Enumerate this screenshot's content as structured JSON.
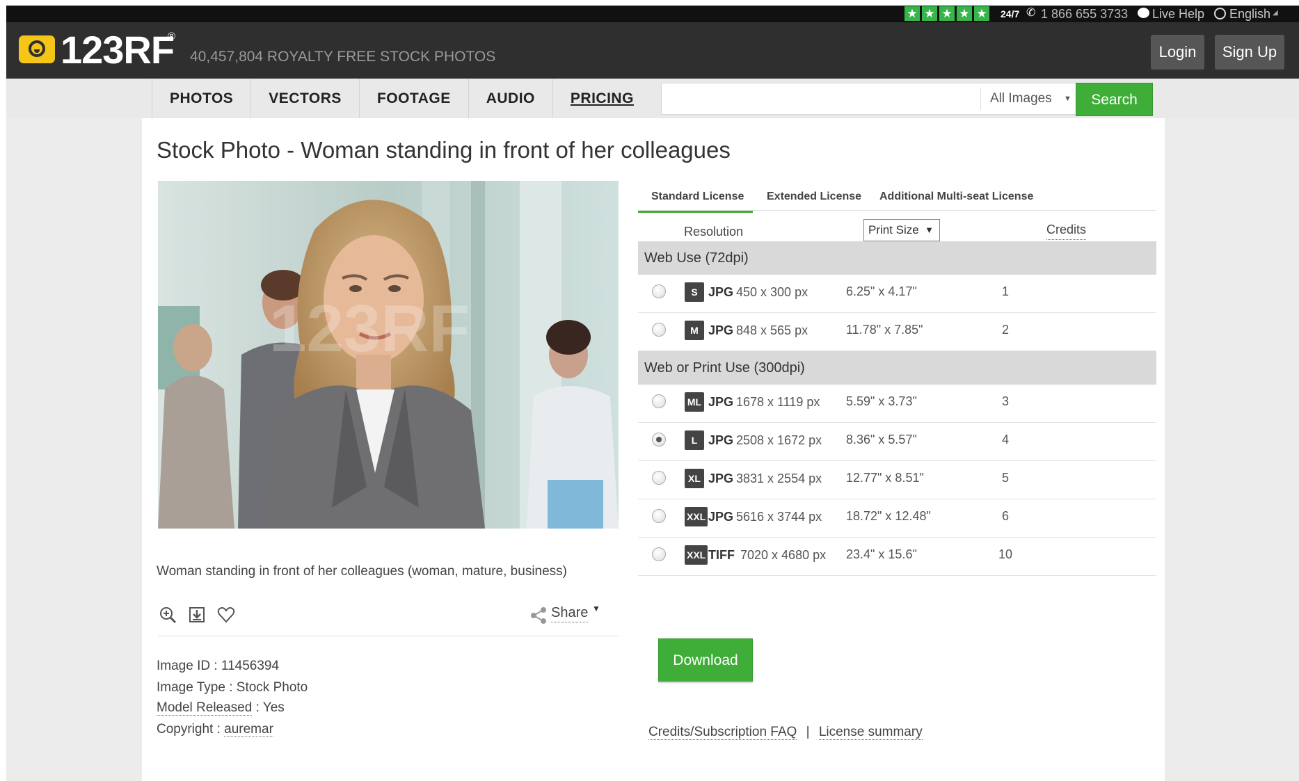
{
  "topbar": {
    "rating_stars": [
      "★",
      "★",
      "★",
      "★",
      "★"
    ],
    "support": "24/7",
    "phone": "1 866 655 3733",
    "live_help": "Live Help",
    "language": "English"
  },
  "header": {
    "logo_text": "123RF",
    "logo_reg": "®",
    "tagline": "40,457,804  ROYALTY FREE STOCK PHOTOS",
    "login": "Login",
    "signup": "Sign Up"
  },
  "nav": {
    "items": [
      "PHOTOS",
      "VECTORS",
      "FOOTAGE",
      "AUDIO",
      "PRICING"
    ]
  },
  "search": {
    "value": "",
    "placeholder": "",
    "filter": "All Images",
    "button": "Search"
  },
  "page": {
    "title": "Stock Photo - Woman standing in front of her colleagues",
    "caption": "Woman standing in front of her colleagues (woman, mature, business)",
    "share": "Share"
  },
  "meta": {
    "image_id_label": "Image ID : ",
    "image_id": "11456394",
    "image_type_label": "Image Type : ",
    "image_type": "Stock Photo",
    "model_released_label": "Model Released",
    "model_released": " : Yes",
    "copyright_label": "Copyright : ",
    "copyright": "auremar"
  },
  "license": {
    "tabs": [
      "Standard License",
      "Extended License",
      "Additional Multi-seat License"
    ],
    "active_tab": "Standard License",
    "columns": {
      "resolution": "Resolution",
      "print_size": "Print Size",
      "credits": "Credits"
    },
    "groups": [
      {
        "name": "Web Use (72dpi)",
        "rows": [
          {
            "badge": "S",
            "format": "JPG",
            "pixels": "450 x 300 px",
            "print": "6.25\" x 4.17\"",
            "credits": "1",
            "selected": false
          },
          {
            "badge": "M",
            "format": "JPG",
            "pixels": "848 x 565 px",
            "print": "11.78\" x 7.85\"",
            "credits": "2",
            "selected": false
          }
        ]
      },
      {
        "name": "Web or Print Use (300dpi)",
        "rows": [
          {
            "badge": "ML",
            "format": "JPG",
            "pixels": "1678 x 1119 px",
            "print": "5.59\" x 3.73\"",
            "credits": "3",
            "selected": false
          },
          {
            "badge": "L",
            "format": "JPG",
            "pixels": "2508 x 1672 px",
            "print": "8.36\" x 5.57\"",
            "credits": "4",
            "selected": true
          },
          {
            "badge": "XL",
            "format": "JPG",
            "pixels": "3831 x 2554 px",
            "print": "12.77\" x 8.51\"",
            "credits": "5",
            "selected": false
          },
          {
            "badge": "XXL",
            "format": "JPG",
            "pixels": "5616 x 3744 px",
            "print": "18.72\" x 12.48\"",
            "credits": "6",
            "selected": false
          },
          {
            "badge": "XXL",
            "format": "TIFF",
            "pixels": "7020 x 4680 px",
            "print": "23.4\" x 15.6\"",
            "credits": "10",
            "selected": false
          }
        ]
      }
    ],
    "download": "Download",
    "faq_link": "Credits/Subscription FAQ",
    "separator": "|",
    "summary_link": "License summary"
  },
  "colors": {
    "accent_green": "#3fae38",
    "header_dark": "#2f2f2f",
    "topbar_black": "#111111",
    "group_gray": "#d9d9d9"
  },
  "icons": [
    "phone-icon",
    "chat-icon",
    "globe-icon",
    "zoom-icon",
    "download-comp-icon",
    "heart-icon",
    "share-icon"
  ]
}
